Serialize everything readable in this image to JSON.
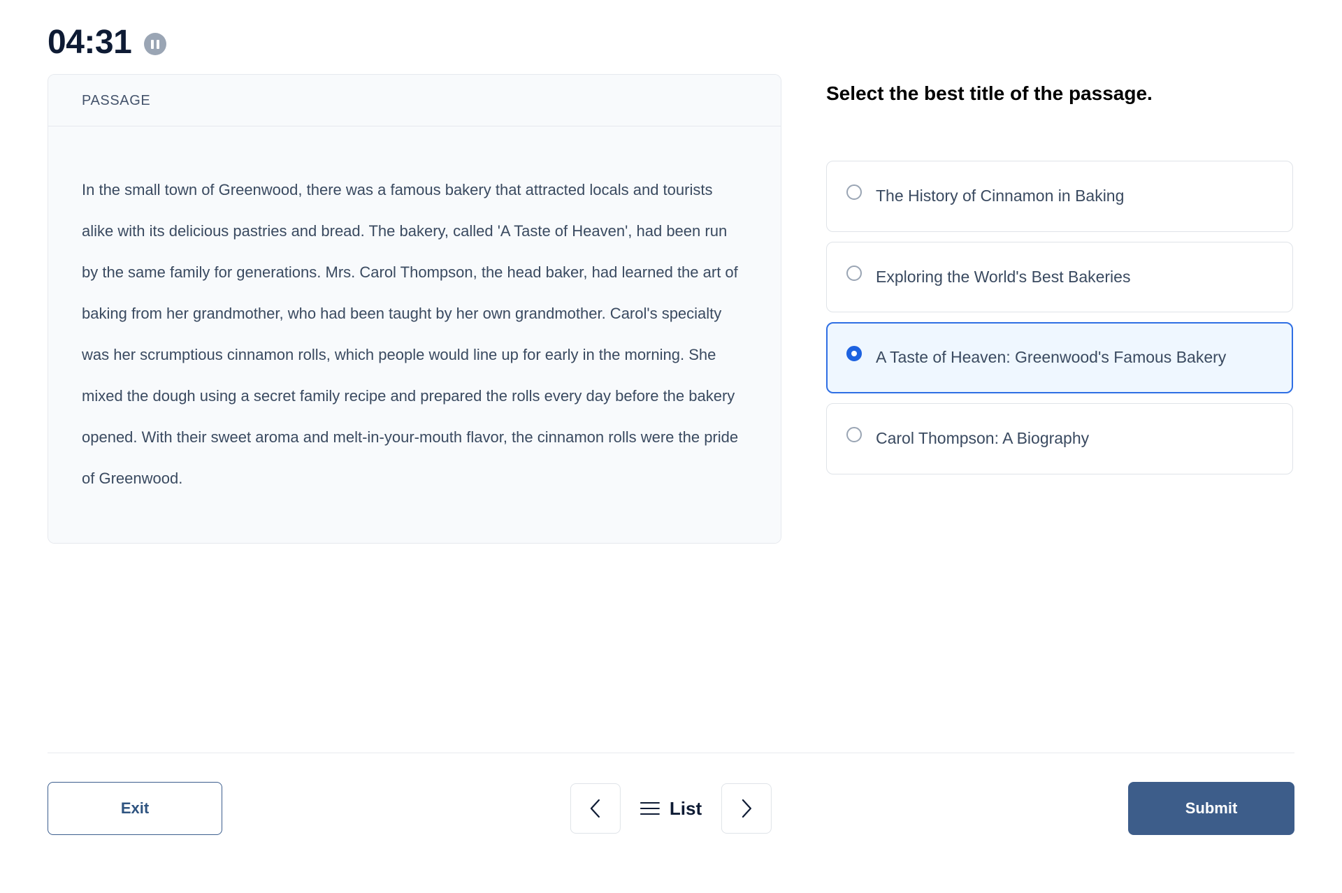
{
  "timer": {
    "value": "04:31",
    "pause_icon": "pause-icon"
  },
  "passage": {
    "header_label": "PASSAGE",
    "text": "In the small town of Greenwood, there was a famous bakery that attracted locals and tourists alike with its delicious pastries and bread. The bakery, called 'A Taste of Heaven', had been run by the same family for generations. Mrs. Carol Thompson, the head baker, had learned the art of baking from her grandmother, who had been taught by her own grandmother. Carol's specialty was her scrumptious cinnamon rolls, which people would line up for early in the morning. She mixed the dough using a secret family recipe and prepared the rolls every day before the bakery opened. With their sweet aroma and melt-in-your-mouth flavor, the cinnamon rolls were the pride of Greenwood."
  },
  "question": {
    "title": "Select the best title of the passage.",
    "options": [
      {
        "label": "The History of Cinnamon in Baking",
        "selected": false
      },
      {
        "label": "Exploring the World's Best Bakeries",
        "selected": false
      },
      {
        "label": "A Taste of Heaven: Greenwood's Famous Bakery",
        "selected": true
      },
      {
        "label": "Carol Thompson: A Biography",
        "selected": false
      }
    ]
  },
  "footer": {
    "exit_label": "Exit",
    "prev_icon": "chevron-left-icon",
    "list_label": "List",
    "list_icon": "hamburger-icon",
    "next_icon": "chevron-right-icon",
    "submit_label": "Submit"
  },
  "colors": {
    "accent_selected": "#2f6fe4",
    "radio_filled": "#1d62e0",
    "submit_bg": "#3d5d8a",
    "exit_border": "#3c5e8e",
    "timer_text": "#0e1b34",
    "panel_bg": "#f8fafc"
  }
}
